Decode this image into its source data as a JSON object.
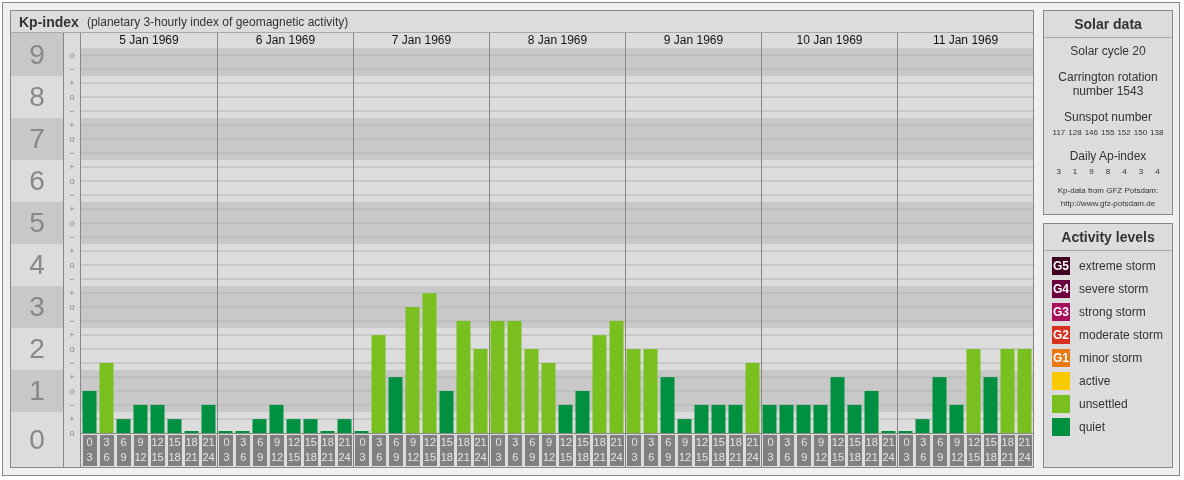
{
  "header": {
    "title": "Kp-index",
    "subtitle": "(planetary 3-hourly index of geomagnetic activity)"
  },
  "kp_sub_marks": [
    [
      "o",
      "−"
    ],
    [
      "+",
      "o",
      "−"
    ],
    [
      "+",
      "o",
      "−"
    ],
    [
      "+",
      "o",
      "−"
    ],
    [
      "+",
      "o",
      "−"
    ],
    [
      "+",
      "o",
      "−"
    ],
    [
      "+",
      "o",
      "−"
    ],
    [
      "+",
      "o",
      "−"
    ],
    [
      "+",
      "o",
      "−"
    ],
    [
      "+",
      "o"
    ]
  ],
  "days": [
    {
      "date": "5 Jan 1969"
    },
    {
      "date": "6 Jan 1969"
    },
    {
      "date": "7 Jan 1969"
    },
    {
      "date": "8 Jan 1969"
    },
    {
      "date": "9 Jan 1969"
    },
    {
      "date": "10 Jan 1969"
    },
    {
      "date": "11 Jan 1969"
    }
  ],
  "chart_data": {
    "type": "bar",
    "stacked": true,
    "ylim": [
      0,
      9.17
    ],
    "grid": true,
    "yticks": [
      {
        "value": 9,
        "label": "9"
      },
      {
        "value": 8,
        "label": "8"
      },
      {
        "value": 7,
        "label": "7"
      },
      {
        "value": 6,
        "label": "6"
      },
      {
        "value": 5,
        "label": "5"
      },
      {
        "value": 4,
        "label": "4"
      },
      {
        "value": 3,
        "label": "3"
      },
      {
        "value": 2,
        "label": "2"
      },
      {
        "value": 1,
        "label": "1"
      },
      {
        "value": 0,
        "label": "0"
      }
    ],
    "categories": [
      "0\n3",
      "3\n6",
      "6\n9",
      "9\n12",
      "12\n15",
      "15\n18",
      "18\n21",
      "21\n24",
      "0\n3",
      "3\n6",
      "6\n9",
      "9\n12",
      "12\n15",
      "15\n18",
      "18\n21",
      "21\n24",
      "0\n3",
      "3\n6",
      "6\n9",
      "9\n12",
      "12\n15",
      "15\n18",
      "18\n21",
      "21\n24",
      "0\n3",
      "3\n6",
      "6\n9",
      "9\n12",
      "12\n15",
      "15\n18",
      "18\n21",
      "21\n24",
      "0\n3",
      "3\n6",
      "6\n9",
      "9\n12",
      "12\n15",
      "15\n18",
      "18\n21",
      "21\n24",
      "0\n3",
      "3\n6",
      "6\n9",
      "9\n12",
      "12\n15",
      "15\n18",
      "18\n21",
      "21\n24",
      "0\n3",
      "3\n6",
      "6\n9",
      "9\n12",
      "12\n15",
      "15\n18",
      "18\n21",
      "21\n24"
    ],
    "series": [
      {
        "color": "#009040",
        "values": [
          1,
          null,
          0.33,
          0.67,
          0.67,
          0.33,
          0,
          0.67,
          0,
          0,
          0.33,
          0.67,
          0.33,
          0.33,
          0,
          0.33,
          0,
          null,
          1.33,
          null,
          null,
          1,
          null,
          null,
          null,
          null,
          null,
          null,
          0.67,
          1,
          null,
          null,
          null,
          null,
          1.33,
          0.33,
          0.67,
          0.67,
          0.67,
          null,
          0.67,
          0.67,
          0.67,
          0.67,
          1.33,
          0.67,
          1,
          0,
          0,
          0.33,
          1.33,
          0.67,
          null,
          1.33,
          null,
          null
        ]
      },
      {
        "color": "#7abf20",
        "values": [
          null,
          1.67,
          null,
          null,
          null,
          null,
          null,
          null,
          null,
          null,
          null,
          null,
          null,
          null,
          null,
          null,
          null,
          2.33,
          null,
          3,
          3.33,
          null,
          2.67,
          2,
          2.67,
          2.67,
          2,
          1.67,
          null,
          null,
          2.33,
          2.67,
          2,
          2,
          null,
          null,
          null,
          null,
          null,
          1.67,
          null,
          null,
          null,
          null,
          null,
          null,
          null,
          null,
          null,
          null,
          null,
          null,
          2,
          null,
          2,
          2
        ]
      }
    ]
  },
  "solar_data": {
    "title": "Solar data",
    "cycle": "Solar cycle 20",
    "rotation": "Carrington rotation number 1543",
    "sunspot_title": "Sunspot number",
    "sunspots": [
      "117",
      "128",
      "146",
      "155",
      "152",
      "150",
      "138"
    ],
    "ap_title": "Daily Ap-index",
    "ap": [
      "3",
      "1",
      "9",
      "8",
      "4",
      "3",
      "4"
    ],
    "source": "Kp-data from GFZ Potsdam:",
    "source_url": "http://www.gfz-potsdam.de"
  },
  "activity_levels": {
    "title": "Activity levels",
    "items": [
      {
        "badge": "G5",
        "label": "extreme storm",
        "color": "#400020"
      },
      {
        "badge": "G4",
        "label": "severe storm",
        "color": "#6a0040"
      },
      {
        "badge": "G3",
        "label": "strong storm",
        "color": "#a8105c"
      },
      {
        "badge": "G2",
        "label": "moderate storm",
        "color": "#d83020"
      },
      {
        "badge": "G1",
        "label": "minor storm",
        "color": "#e87818"
      },
      {
        "label": "active",
        "color": "#f8c800"
      },
      {
        "label": "unsettled",
        "color": "#7abf20"
      },
      {
        "label": "quiet",
        "color": "#009040"
      }
    ]
  }
}
